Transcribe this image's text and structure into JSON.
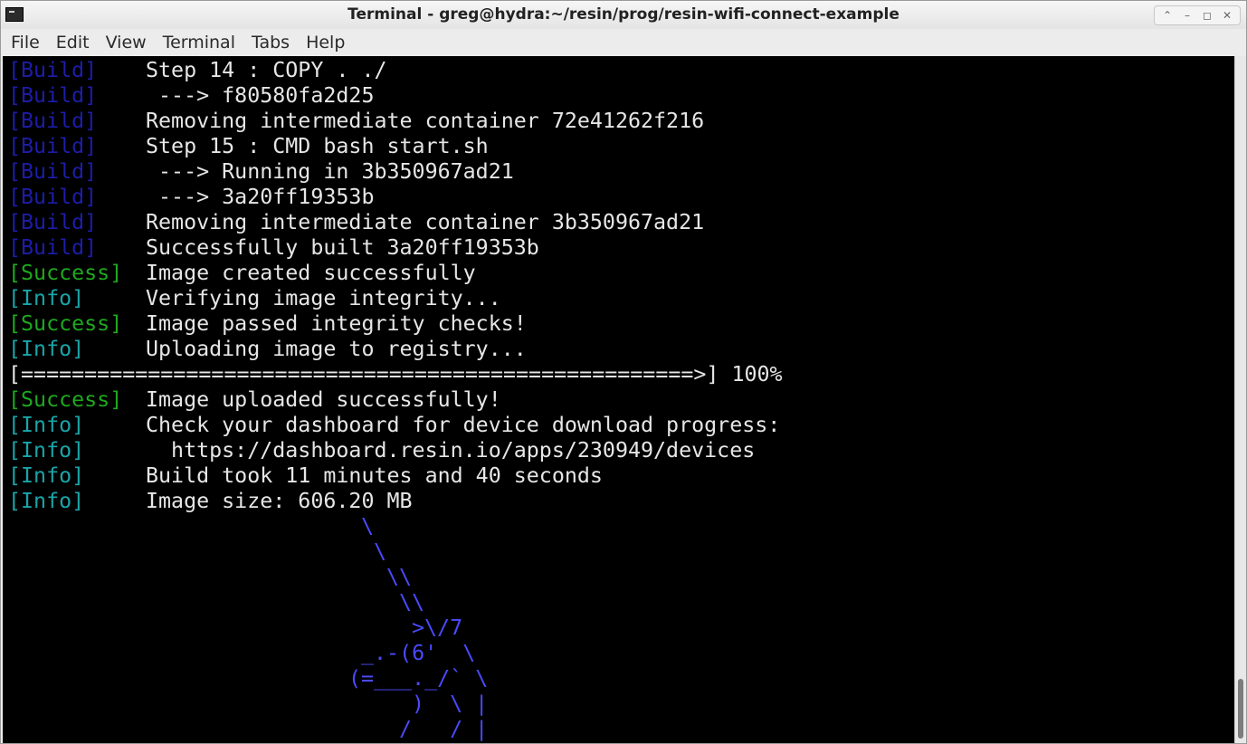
{
  "window": {
    "title": "Terminal - greg@hydra:~/resin/prog/resin-wifi-connect-example",
    "controls": [
      "⌃",
      "–",
      "◻",
      "✕"
    ]
  },
  "menubar": [
    "File",
    "Edit",
    "View",
    "Terminal",
    "Tabs",
    "Help"
  ],
  "colors": {
    "build": "#1d1da8",
    "success": "#1ea81e",
    "info": "#1aa5a8",
    "text": "#e6e6e6",
    "art": "#4a4aff",
    "background": "#000000"
  },
  "terminal": {
    "lines": [
      {
        "tag": "[Build]",
        "kind": "build",
        "text": "Step 14 : COPY . ./"
      },
      {
        "tag": "[Build]",
        "kind": "build",
        "text": " ---> f80580fa2d25"
      },
      {
        "tag": "[Build]",
        "kind": "build",
        "text": "Removing intermediate container 72e41262f216"
      },
      {
        "tag": "[Build]",
        "kind": "build",
        "text": "Step 15 : CMD bash start.sh"
      },
      {
        "tag": "[Build]",
        "kind": "build",
        "text": " ---> Running in 3b350967ad21"
      },
      {
        "tag": "[Build]",
        "kind": "build",
        "text": " ---> 3a20ff19353b"
      },
      {
        "tag": "[Build]",
        "kind": "build",
        "text": "Removing intermediate container 3b350967ad21"
      },
      {
        "tag": "[Build]",
        "kind": "build",
        "text": "Successfully built 3a20ff19353b"
      },
      {
        "tag": "[Success]",
        "kind": "success",
        "text": "Image created successfully"
      },
      {
        "tag": "[Info]",
        "kind": "info",
        "text": "Verifying image integrity..."
      },
      {
        "tag": "[Success]",
        "kind": "success",
        "text": "Image passed integrity checks!"
      },
      {
        "tag": "[Info]",
        "kind": "info",
        "text": "Uploading image to registry..."
      }
    ],
    "progress": "[=====================================================>] 100%",
    "progress_percent": 100,
    "lines_after": [
      {
        "tag": "[Success]",
        "kind": "success",
        "text": "Image uploaded successfully!"
      },
      {
        "tag": "[Info]",
        "kind": "info",
        "text": "Check your dashboard for device download progress:"
      },
      {
        "tag": "[Info]",
        "kind": "info",
        "text": "  https://dashboard.resin.io/apps/230949/devices"
      },
      {
        "tag": "[Info]",
        "kind": "info",
        "text": "Build took 11 minutes and 40 seconds"
      },
      {
        "tag": "[Info]",
        "kind": "info",
        "text": "Image size: 606.20 MB"
      }
    ],
    "ascii_art": [
      "\\",
      " \\",
      "  \\\\",
      "   \\\\",
      "    >\\/7",
      "_.-(6'  \\",
      "(=___._/` \\",
      "     )  \\ |",
      "    /   / |"
    ]
  }
}
